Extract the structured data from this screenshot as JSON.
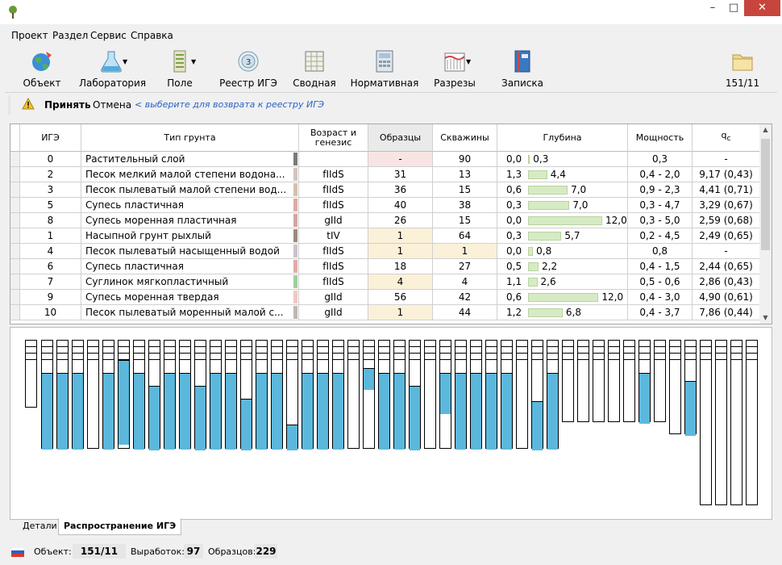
{
  "menu": [
    "Проект",
    "Раздел",
    "Сервис",
    "Справка"
  ],
  "toolbar": {
    "buttons": [
      {
        "label": "Объект",
        "icon": "globe-icon"
      },
      {
        "label": "Лаборатория",
        "icon": "lab-flask-icon"
      },
      {
        "label": "Поле",
        "icon": "field-drill-icon"
      },
      {
        "label": "Реестр ИГЭ",
        "icon": "layers-registry-icon"
      },
      {
        "label": "Сводная",
        "icon": "summary-table-icon"
      },
      {
        "label": "Нормативная",
        "icon": "calculator-icon"
      },
      {
        "label": "Разрезы",
        "icon": "cross-section-icon"
      },
      {
        "label": "Записка",
        "icon": "notebook-icon"
      },
      {
        "label": "151/11",
        "icon": "folder-icon"
      }
    ]
  },
  "actionbar": {
    "accept": "Принять",
    "cancel": "Отмена",
    "hint": "< выберите для возврата к реестру ИГЭ"
  },
  "grid": {
    "headers": {
      "ige": "ИГЭ",
      "type": "Тип грунта",
      "age": "Возраст и генезис",
      "samples": "Образцы",
      "wells": "Скважины",
      "depth": "Глубина",
      "thickness": "Мощность",
      "qc": "qc"
    },
    "rows": [
      {
        "ige": "0",
        "type": "Растительный слой",
        "age": "",
        "samples": "-",
        "wells": "90",
        "depth_from": "0,0",
        "depth_to": "0,3",
        "thickness": "0,3",
        "qc": "-",
        "color": "#7a7a7a",
        "samples_bg": "#f9e4e4",
        "wells_bg": ""
      },
      {
        "ige": "2",
        "type": "Песок мелкий малой степени водона...",
        "age": "fIIdS",
        "samples": "31",
        "wells": "13",
        "depth_from": "1,3",
        "depth_to": "4,4",
        "thickness": "0,4 - 2,0",
        "qc": "9,17 (0,43)",
        "color": "#cfc6bf",
        "samples_bg": "",
        "wells_bg": ""
      },
      {
        "ige": "3",
        "type": "Песок пылеватый малой степени вод...",
        "age": "fIIdS",
        "samples": "36",
        "wells": "15",
        "depth_from": "0,6",
        "depth_to": "7,0",
        "thickness": "0,9 - 2,3",
        "qc": "4,41 (0,71)",
        "color": "#d2c2a8",
        "samples_bg": "",
        "wells_bg": ""
      },
      {
        "ige": "5",
        "type": "Супесь пластичная",
        "age": "fIIdS",
        "samples": "40",
        "wells": "38",
        "depth_from": "0,3",
        "depth_to": "7,0",
        "thickness": "0,3 - 4,7",
        "qc": "3,29 (0,67)",
        "color": "#e0a9a4",
        "samples_bg": "",
        "wells_bg": ""
      },
      {
        "ige": "8",
        "type": "Супесь моренная пластичная",
        "age": "gIId",
        "samples": "26",
        "wells": "15",
        "depth_from": "0,0",
        "depth_to": "12,0",
        "thickness": "0,3 - 5,0",
        "qc": "2,59 (0,68)",
        "color": "#d7a3a0",
        "samples_bg": "",
        "wells_bg": ""
      },
      {
        "ige": "1",
        "type": "Насыпной грунт рыхлый",
        "age": "tIV",
        "samples": "1",
        "wells": "64",
        "depth_from": "0,3",
        "depth_to": "5,7",
        "thickness": "0,2 - 4,5",
        "qc": "2,49 (0,65)",
        "color": "#9a8a7a",
        "samples_bg": "#fbf1d9",
        "wells_bg": ""
      },
      {
        "ige": "4",
        "type": "Песок пылеватый насыщенный водой",
        "age": "fIIdS",
        "samples": "1",
        "wells": "1",
        "depth_from": "0,0",
        "depth_to": "0,8",
        "thickness": "0,8",
        "qc": "-",
        "color": "#c9c3c8",
        "samples_bg": "#fbf1d9",
        "wells_bg": "#fbf1d9"
      },
      {
        "ige": "6",
        "type": "Супесь пластичная",
        "age": "fIIdS",
        "samples": "18",
        "wells": "27",
        "depth_from": "0,5",
        "depth_to": "2,2",
        "thickness": "0,4 - 1,5",
        "qc": "2,44 (0,65)",
        "color": "#e3aaa8",
        "samples_bg": "",
        "wells_bg": ""
      },
      {
        "ige": "7",
        "type": "Суглинок мягкопластичный",
        "age": "fIIdS",
        "samples": "4",
        "wells": "4",
        "depth_from": "1,1",
        "depth_to": "2,6",
        "thickness": "0,5 - 0,6",
        "qc": "2,86 (0,43)",
        "color": "#9fcf9b",
        "samples_bg": "#fbf1d9",
        "wells_bg": ""
      },
      {
        "ige": "9",
        "type": "Супесь моренная твердая",
        "age": "gIId",
        "samples": "56",
        "wells": "42",
        "depth_from": "0,6",
        "depth_to": "12,0",
        "thickness": "0,4 - 3,0",
        "qc": "4,90 (0,61)",
        "color": "#f2c6c4",
        "samples_bg": "",
        "wells_bg": ""
      },
      {
        "ige": "10",
        "type": "Песок пылеватый моренный малой с...",
        "age": "gIId",
        "samples": "1",
        "wells": "44",
        "depth_from": "1,2",
        "depth_to": "6,8",
        "thickness": "0,4 - 3,7",
        "qc": "7,86 (0,44)",
        "color": "#c2b6ad",
        "samples_bg": "#fbf1d9",
        "wells_bg": ""
      }
    ],
    "depth_max": 12.0
  },
  "spread_panel": {
    "fill_color": "#5bb8dc"
  },
  "tabs": [
    "Детали",
    "Распространение ИГЭ"
  ],
  "status": {
    "object_label": "Объект:",
    "object_value": "151/11",
    "workings_label": "Выработок:",
    "workings_value": "97",
    "samples_label": "Образцов:",
    "samples_value": "229"
  }
}
